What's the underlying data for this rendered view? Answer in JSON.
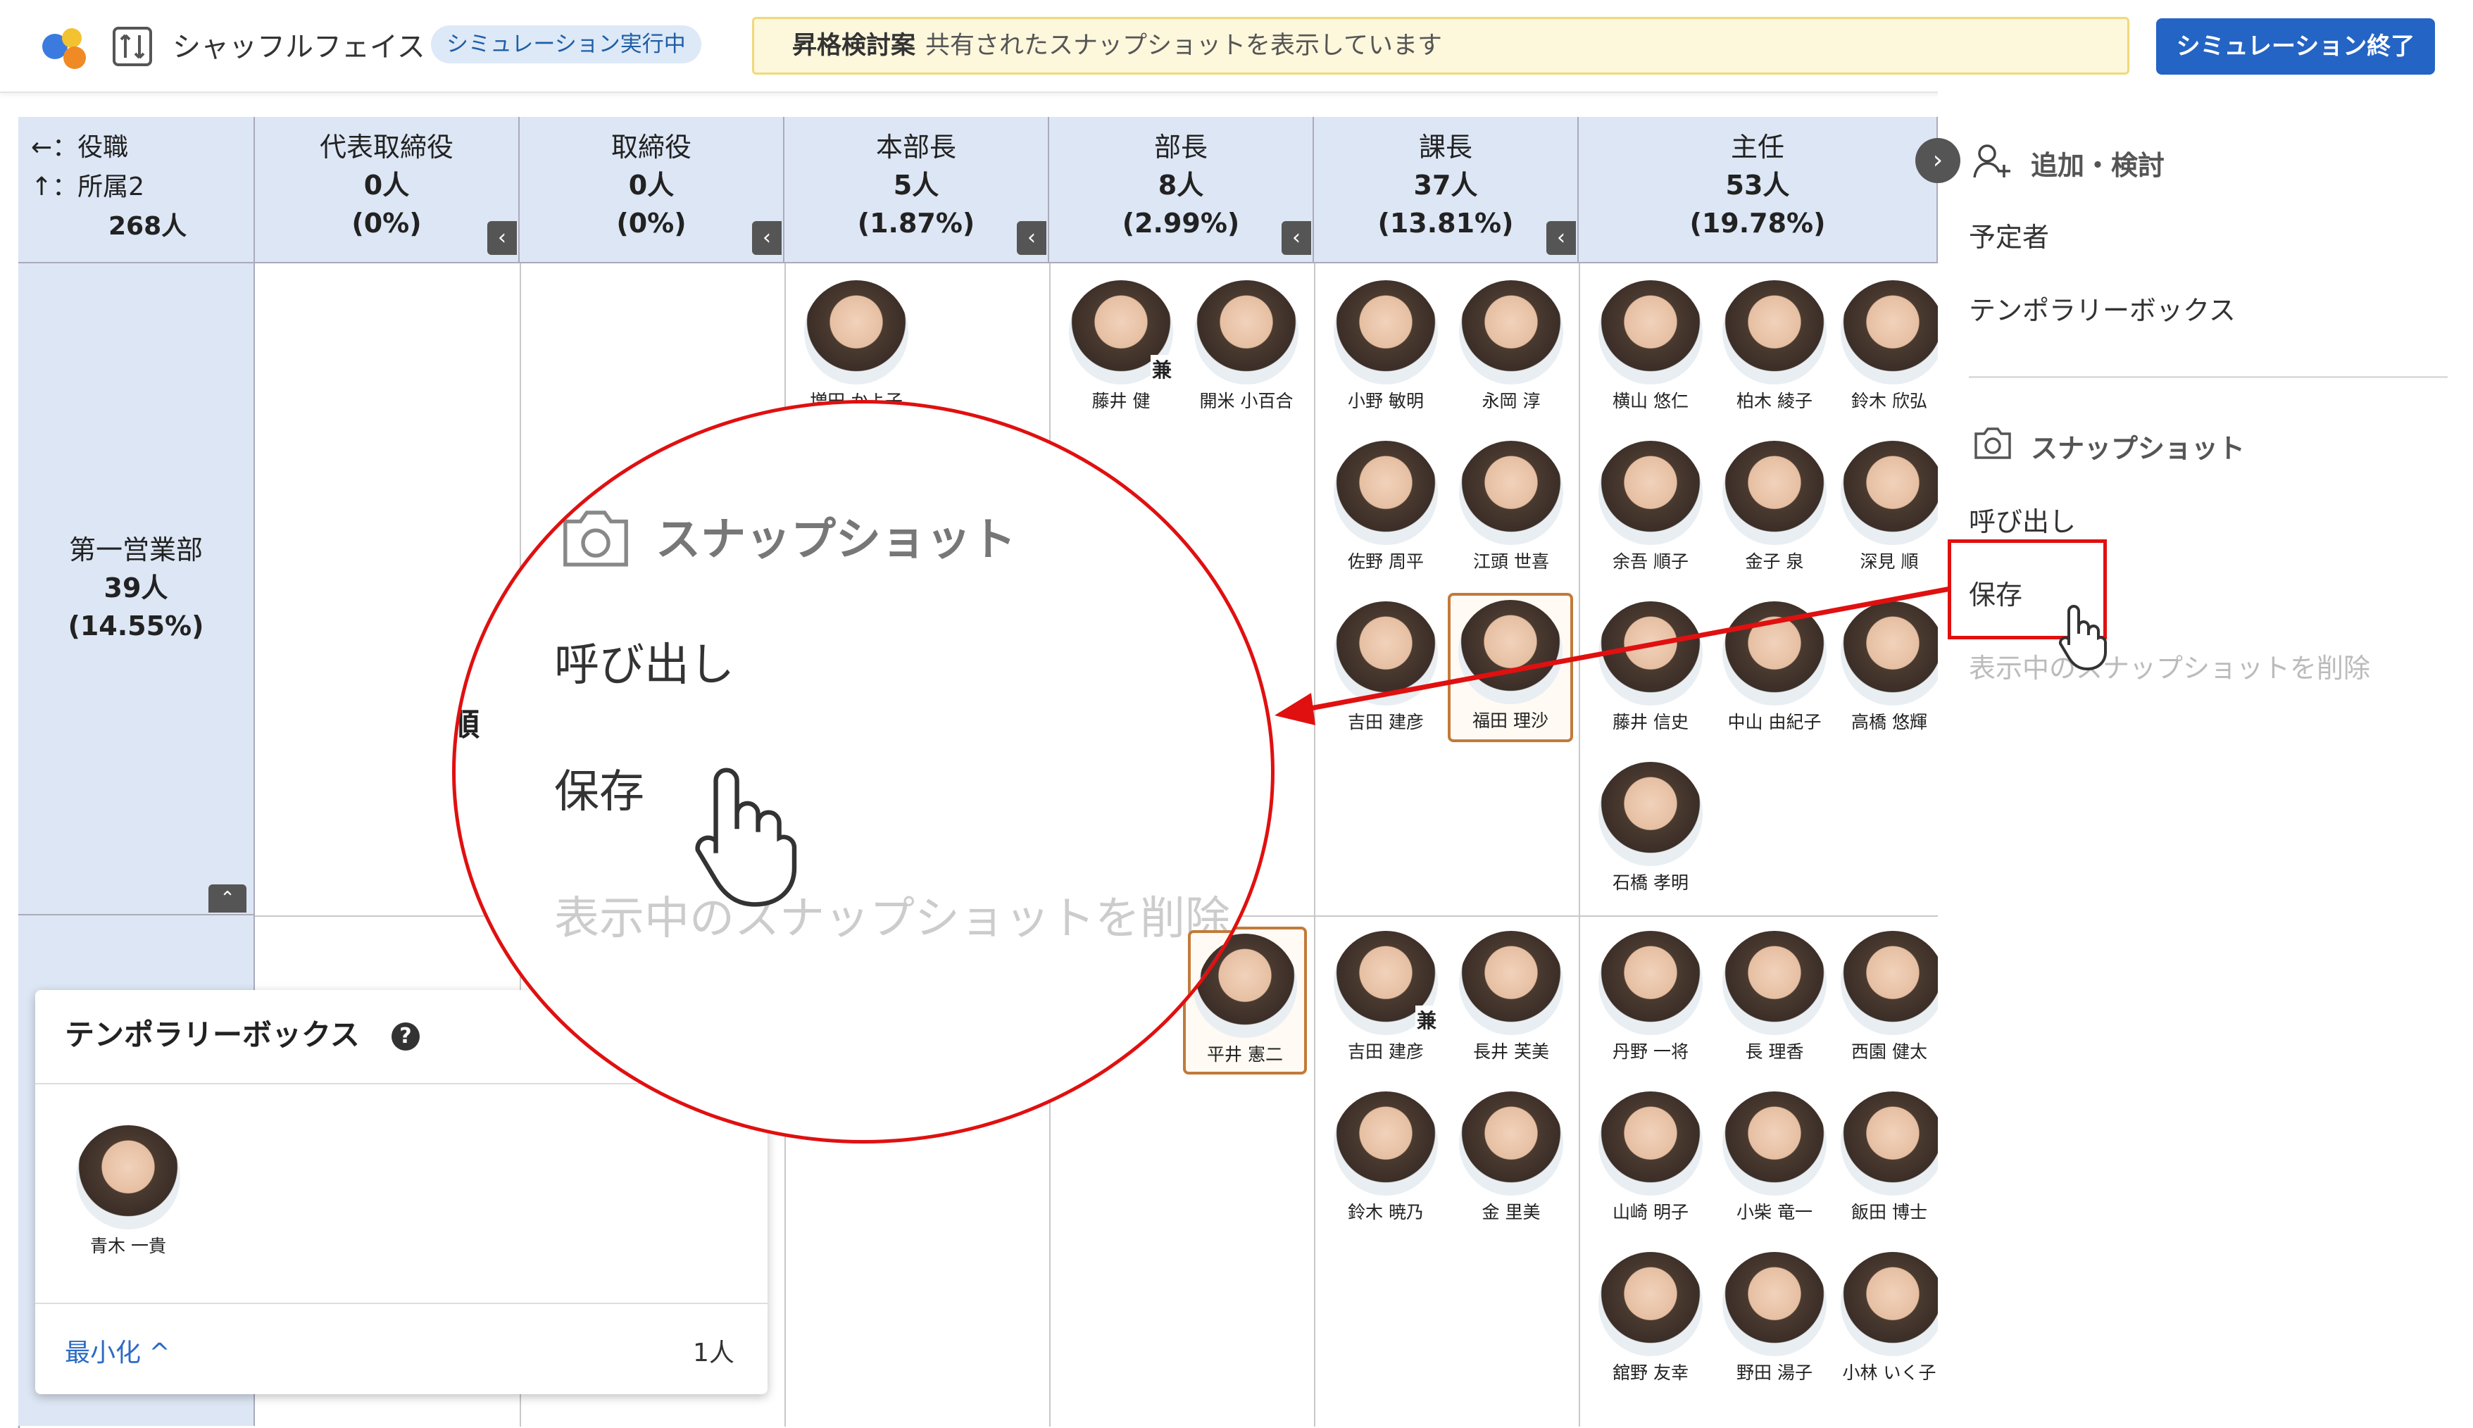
{
  "header": {
    "app_title": "シャッフルフェイス",
    "sim_badge": "シミュレーション実行中",
    "notice_bold": "昇格検討案",
    "notice_text": "共有されたスナップショットを表示しています",
    "end_button": "シミュレーション終了",
    "logo_icon": "app-logo-icon",
    "shuffle_icon": "shuffle-icon"
  },
  "axis": {
    "row1": "←：役職",
    "row2": "↑：所属2",
    "total": "268人"
  },
  "columns": [
    {
      "title": "代表取締役",
      "count": "0人",
      "pct": "(0%)"
    },
    {
      "title": "取締役",
      "count": "0人",
      "pct": "(0%)"
    },
    {
      "title": "本部長",
      "count": "5人",
      "pct": "(1.87%)"
    },
    {
      "title": "部長",
      "count": "8人",
      "pct": "(2.99%)"
    },
    {
      "title": "課長",
      "count": "37人",
      "pct": "(13.81%)"
    },
    {
      "title": "主任",
      "count": "53人",
      "pct": "(19.78%)"
    }
  ],
  "departments": [
    {
      "name": "第一営業部",
      "count": "39人",
      "pct": "(14.55%)"
    }
  ],
  "people": {
    "honbu": [
      "増田 かよ子"
    ],
    "bucho": [
      "藤井 健",
      "開米 小百合"
    ],
    "kacho_r1": [
      "小野 敏明",
      "永岡 淳",
      "佐野 周平",
      "江頭 世喜",
      "吉田 建彦",
      "福田 理沙"
    ],
    "shunin_r1": [
      "横山 悠仁",
      "柏木 綾子",
      "鈴木 欣弘",
      "余吾 順子",
      "金子 泉",
      "深見 順",
      "藤井 信史",
      "中山 由紀子",
      "高橋 悠輝",
      "石橋 孝明"
    ],
    "bucho_r2": [
      "平井 憲二"
    ],
    "kacho_r2": [
      "吉田 建彦",
      "長井 芙美",
      "鈴木 暁乃",
      "金 里美"
    ],
    "shunin_r2": [
      "丹野 一将",
      "長 理香",
      "西園 健太",
      "山崎 明子",
      "小柴 竜一",
      "飯田 博士",
      "舘野 友幸",
      "野田 湯子",
      "小林 いく子"
    ],
    "partial_left": "順",
    "partial_left2": "子",
    "ken_mark": "兼"
  },
  "right_panel": {
    "add_section": "追加・検討",
    "candidates": "予定者",
    "temporary_box": "テンポラリーボックス",
    "snapshot_section": "スナップショット",
    "recall": "呼び出し",
    "save": "保存",
    "delete": "表示中のスナップショットを削除"
  },
  "temp_box": {
    "title": "テンポラリーボックス",
    "help": "?",
    "person": "青木 一貴",
    "minimize": "最小化 ^",
    "count": "1人"
  },
  "zoom": {
    "section": "スナップショット",
    "recall": "呼び出し",
    "save": "保存",
    "delete": "表示中のスナップショットを削除"
  },
  "colors": {
    "accent": "#2464c4",
    "header_cell": "#dde6f4",
    "highlight_red": "#e01010",
    "selected_border": "#c27a3a",
    "notice_bg": "#fdf7dc"
  }
}
